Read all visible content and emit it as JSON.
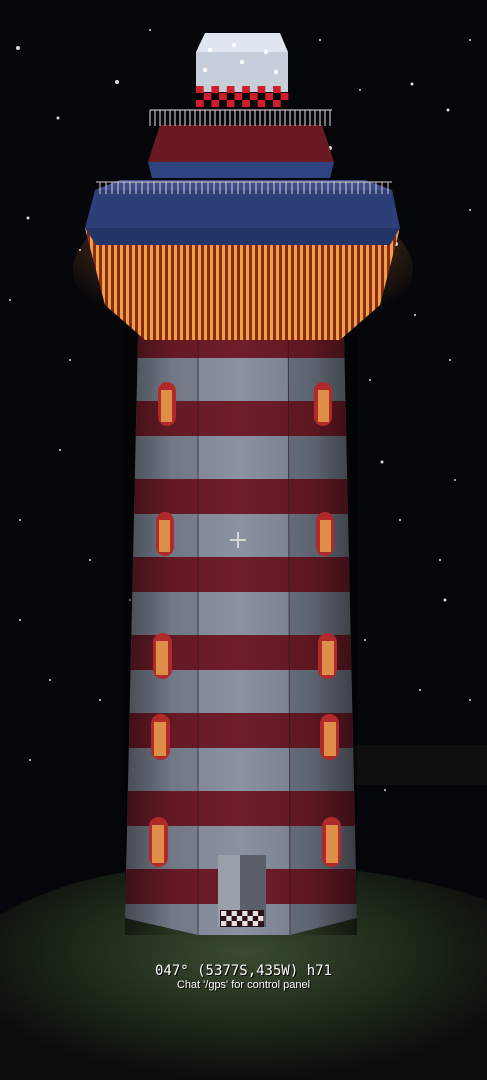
{
  "hud": {
    "gps_readout": "047° (5377S,435W) h71",
    "hint": "Chat '/gps' for control panel"
  },
  "colors": {
    "sky": "#05060a",
    "stripe_red": "#6e1420",
    "stripe_grey": "#7d8594",
    "window_glow": "#e8a050",
    "gallery_glow": "#e07a30",
    "lantern": "#dfe6f0",
    "ground": "#1c2a18"
  },
  "icons": {
    "crosshair": "crosshair-icon"
  }
}
